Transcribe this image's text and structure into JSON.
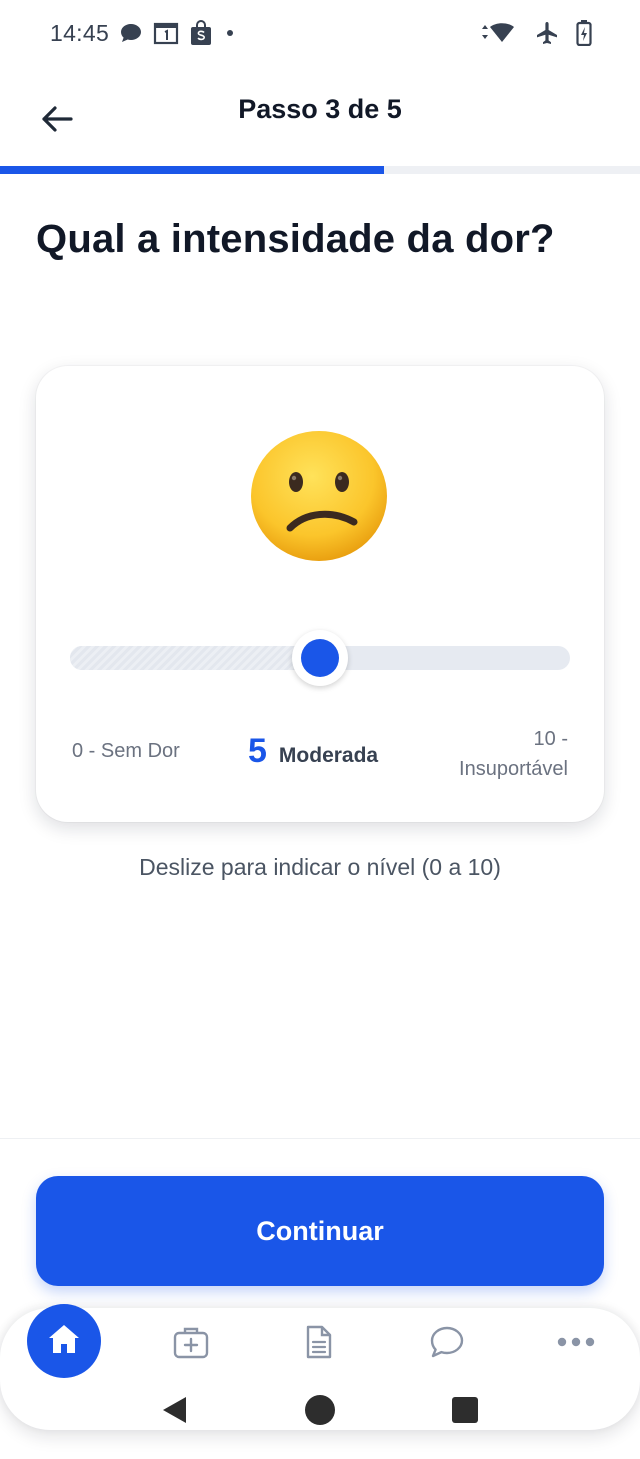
{
  "status_bar": {
    "time": "14:45",
    "left_icons": [
      "chat-bubble-icon",
      "calendar-icon",
      "shop-bag-icon",
      "dot-icon"
    ],
    "right_icons": [
      "wifi-icon",
      "airplane-icon",
      "battery-charging-icon"
    ]
  },
  "header": {
    "title": "Passo 3 de 5",
    "back_icon": "arrow-left-icon"
  },
  "progress": {
    "current": 3,
    "total": 5
  },
  "question": "Qual a intensidade da dor?",
  "pain_scale": {
    "emoji": "confused-face-icon",
    "min": 0,
    "max": 10,
    "value": 5,
    "min_label": "0 - Sem Dor",
    "current_number": "5",
    "current_label": "Moderada",
    "max_label_line1": "10 -",
    "max_label_line2": "Insuportável"
  },
  "hint": "Deslize para indicar o nível (0 a 10)",
  "cta_label": "Continuar",
  "bottom_nav": {
    "items": [
      "home-icon",
      "medical-kit-icon",
      "document-icon",
      "chat-icon",
      "more-icon"
    ],
    "active": "home-icon"
  },
  "colors": {
    "primary": "#1a56e8",
    "text_dark": "#111827",
    "text_muted": "#6b7280",
    "track": "#e6eaf1"
  }
}
